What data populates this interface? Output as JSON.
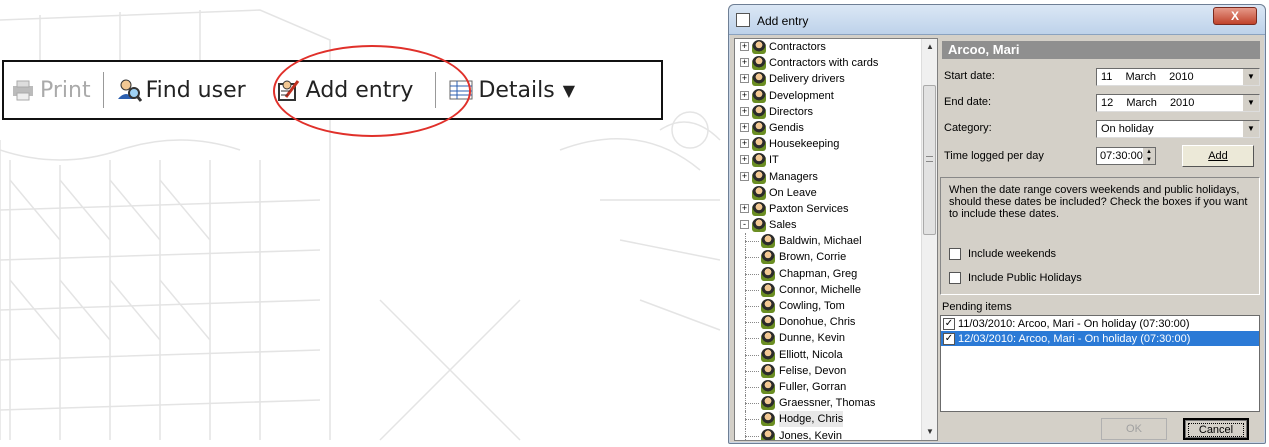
{
  "toolbar": {
    "print_label": "Print",
    "find_user_label": "Find user",
    "add_entry_label": "Add entry",
    "details_label": "Details",
    "highlight_color": "#e0302a"
  },
  "dialog": {
    "title": "Add entry",
    "close_symbol": "X",
    "tree": {
      "items": [
        {
          "label": "Contractors",
          "level": 0,
          "expander": "+"
        },
        {
          "label": "Contractors with cards",
          "level": 0,
          "expander": "+"
        },
        {
          "label": "Delivery drivers",
          "level": 0,
          "expander": "+"
        },
        {
          "label": "Development",
          "level": 0,
          "expander": "+"
        },
        {
          "label": "Directors",
          "level": 0,
          "expander": "+"
        },
        {
          "label": "Gendis",
          "level": 0,
          "expander": "+"
        },
        {
          "label": "Housekeeping",
          "level": 0,
          "expander": "+"
        },
        {
          "label": "IT",
          "level": 0,
          "expander": "+"
        },
        {
          "label": "Managers",
          "level": 0,
          "expander": "+"
        },
        {
          "label": "On Leave",
          "level": 0,
          "expander": ""
        },
        {
          "label": "Paxton Services",
          "level": 0,
          "expander": "+"
        },
        {
          "label": "Sales",
          "level": 0,
          "expander": "-"
        },
        {
          "label": "Baldwin, Michael",
          "level": 1,
          "expander": ""
        },
        {
          "label": "Brown, Corrie",
          "level": 1,
          "expander": ""
        },
        {
          "label": "Chapman, Greg",
          "level": 1,
          "expander": ""
        },
        {
          "label": "Connor, Michelle",
          "level": 1,
          "expander": ""
        },
        {
          "label": "Cowling, Tom",
          "level": 1,
          "expander": ""
        },
        {
          "label": "Donohue, Chris",
          "level": 1,
          "expander": ""
        },
        {
          "label": "Dunne, Kevin",
          "level": 1,
          "expander": ""
        },
        {
          "label": "Elliott, Nicola",
          "level": 1,
          "expander": ""
        },
        {
          "label": "Felise, Devon",
          "level": 1,
          "expander": ""
        },
        {
          "label": "Fuller, Gorran",
          "level": 1,
          "expander": ""
        },
        {
          "label": "Graessner, Thomas",
          "level": 1,
          "expander": ""
        },
        {
          "label": "Hodge, Chris",
          "level": 1,
          "expander": "",
          "selected": true
        },
        {
          "label": "Jones, Kevin",
          "level": 1,
          "expander": ""
        }
      ]
    },
    "person_name": "Arcoo, Mari",
    "start_date_label": "Start date:",
    "start_date": {
      "day": "11",
      "month": "March",
      "year": "2010"
    },
    "end_date_label": "End date:",
    "end_date": {
      "day": "12",
      "month": "March",
      "year": "2010"
    },
    "category_label": "Category:",
    "category_value": "On holiday",
    "time_label": "Time logged per day",
    "time_value": "07:30:00",
    "add_button": "Add",
    "info_text": "When the date range covers weekends and public holidays, should these dates be included?  Check the boxes if you want to include these dates.",
    "include_weekends_label": "Include weekends",
    "include_weekends_checked": false,
    "include_holidays_label": "Include Public Holidays",
    "include_holidays_checked": false,
    "pending_label": "Pending items",
    "pending_items": [
      {
        "text": "11/03/2010: Arcoo, Mari - On holiday (07:30:00)",
        "checked": true,
        "selected": false
      },
      {
        "text": "12/03/2010: Arcoo, Mari - On holiday (07:30:00)",
        "checked": true,
        "selected": true
      }
    ],
    "ok_button": "OK",
    "cancel_button": "Cancel",
    "selection_color": "#2b7ad6",
    "header_color": "#8f8f8f"
  }
}
